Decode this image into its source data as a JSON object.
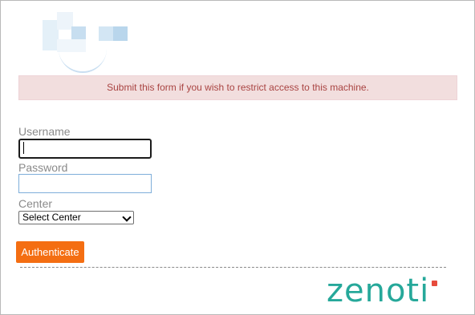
{
  "alert": {
    "message": "Submit this form if you wish to restrict access to this machine."
  },
  "form": {
    "username_label": "Username",
    "username_value": "",
    "password_label": "Password",
    "password_value": "",
    "center_label": "Center",
    "center_selected": "Select Center",
    "submit_label": "Authenticate"
  },
  "footer": {
    "brand_text": "zenoti"
  },
  "colors": {
    "alert_bg": "#f2dede",
    "alert_text": "#a94442",
    "button_bg": "#f46e12",
    "brand_teal": "#26a89a",
    "brand_dot": "#e64b3c"
  }
}
